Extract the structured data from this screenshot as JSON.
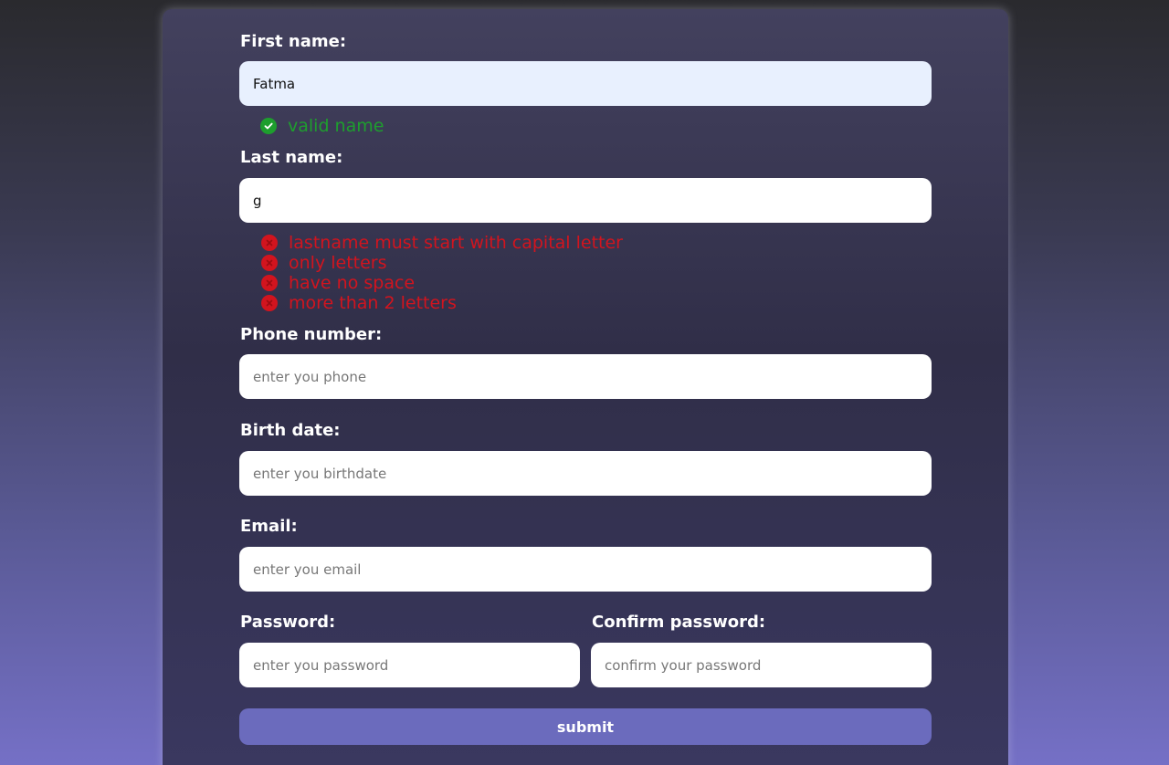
{
  "form": {
    "first_name": {
      "label": "First name:",
      "value": "Fatma",
      "validation": [
        {
          "status": "valid",
          "icon": "check-circle-icon",
          "text": "valid name"
        }
      ]
    },
    "last_name": {
      "label": "Last name:",
      "value": "g",
      "validation": [
        {
          "status": "error",
          "icon": "x-circle-icon",
          "text": "lastname must start with capital letter"
        },
        {
          "status": "error",
          "icon": "x-circle-icon",
          "text": "only letters"
        },
        {
          "status": "error",
          "icon": "x-circle-icon",
          "text": "have no space"
        },
        {
          "status": "error",
          "icon": "x-circle-icon",
          "text": "more than 2 letters"
        }
      ]
    },
    "phone": {
      "label": "Phone number:",
      "placeholder": "enter you phone"
    },
    "birth_date": {
      "label": "Birth date:",
      "placeholder": "enter you birthdate"
    },
    "email": {
      "label": "Email:",
      "placeholder": "enter you email"
    },
    "password": {
      "label": "Password:",
      "placeholder": "enter you password"
    },
    "confirm_password": {
      "label": "Confirm password:",
      "placeholder": "confirm your password"
    },
    "submit_label": "submit"
  },
  "colors": {
    "valid": "#1e9e2e",
    "error": "#d2141e",
    "submit_button": "#6b6bbd"
  }
}
